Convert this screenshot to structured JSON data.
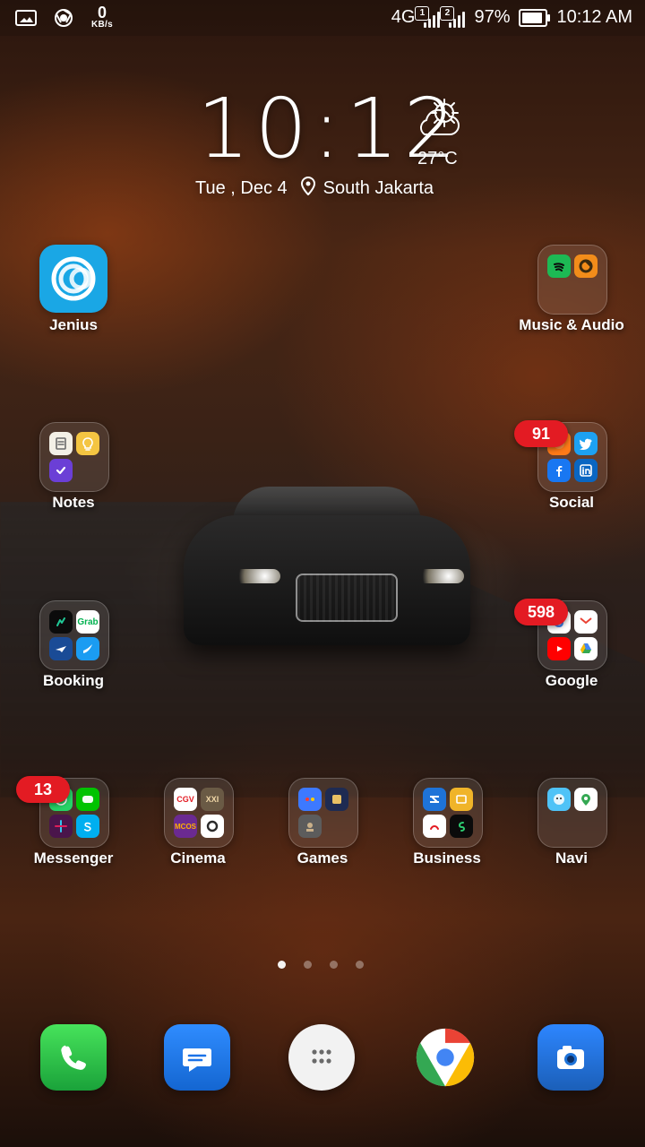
{
  "status_bar": {
    "network_type": "4G",
    "sim1": "1",
    "sim2": "2",
    "battery_percent": "97%",
    "time": "10:12 AM",
    "speed_value": "0",
    "speed_unit": "KB/s",
    "icons": [
      "image-icon",
      "chrome-icon"
    ]
  },
  "clock_widget": {
    "time": "10:12",
    "temperature": "27°C",
    "date": "Tue , Dec 4",
    "location": "South Jakarta",
    "weather_icon": "partly-cloudy-icon",
    "location_icon": "location-pin-icon"
  },
  "apps": {
    "jenius": {
      "label": "Jenius",
      "icon": "jenius-icon",
      "color": "#1aa7e5"
    },
    "music_audio": {
      "label": "Music & Audio"
    },
    "notes": {
      "label": "Notes"
    },
    "social": {
      "label": "Social",
      "badge": "91"
    },
    "booking": {
      "label": "Booking"
    },
    "google": {
      "label": "Google",
      "badge": "598"
    },
    "messenger": {
      "label": "Messenger",
      "badge": "13"
    },
    "cinema": {
      "label": "Cinema"
    },
    "games": {
      "label": "Games"
    },
    "business": {
      "label": "Business"
    },
    "navi": {
      "label": "Navi"
    }
  },
  "mini_icons": {
    "cinema": [
      "CGV",
      "XXI",
      "MCOS",
      ""
    ],
    "booking": [
      "",
      "Grab",
      "",
      ""
    ]
  },
  "dock": {
    "phone": {
      "icon": "phone-icon",
      "color": "#2ecc40"
    },
    "messages": {
      "icon": "messages-icon",
      "color": "#1c73e8"
    },
    "app_drawer": {
      "icon": "app-drawer-icon",
      "color": "#f2f2f2"
    },
    "chrome": {
      "icon": "chrome-icon"
    },
    "camera": {
      "icon": "camera-icon",
      "color": "#1e73d8"
    }
  },
  "page_indicator": {
    "count": 4,
    "active_index": 0
  }
}
